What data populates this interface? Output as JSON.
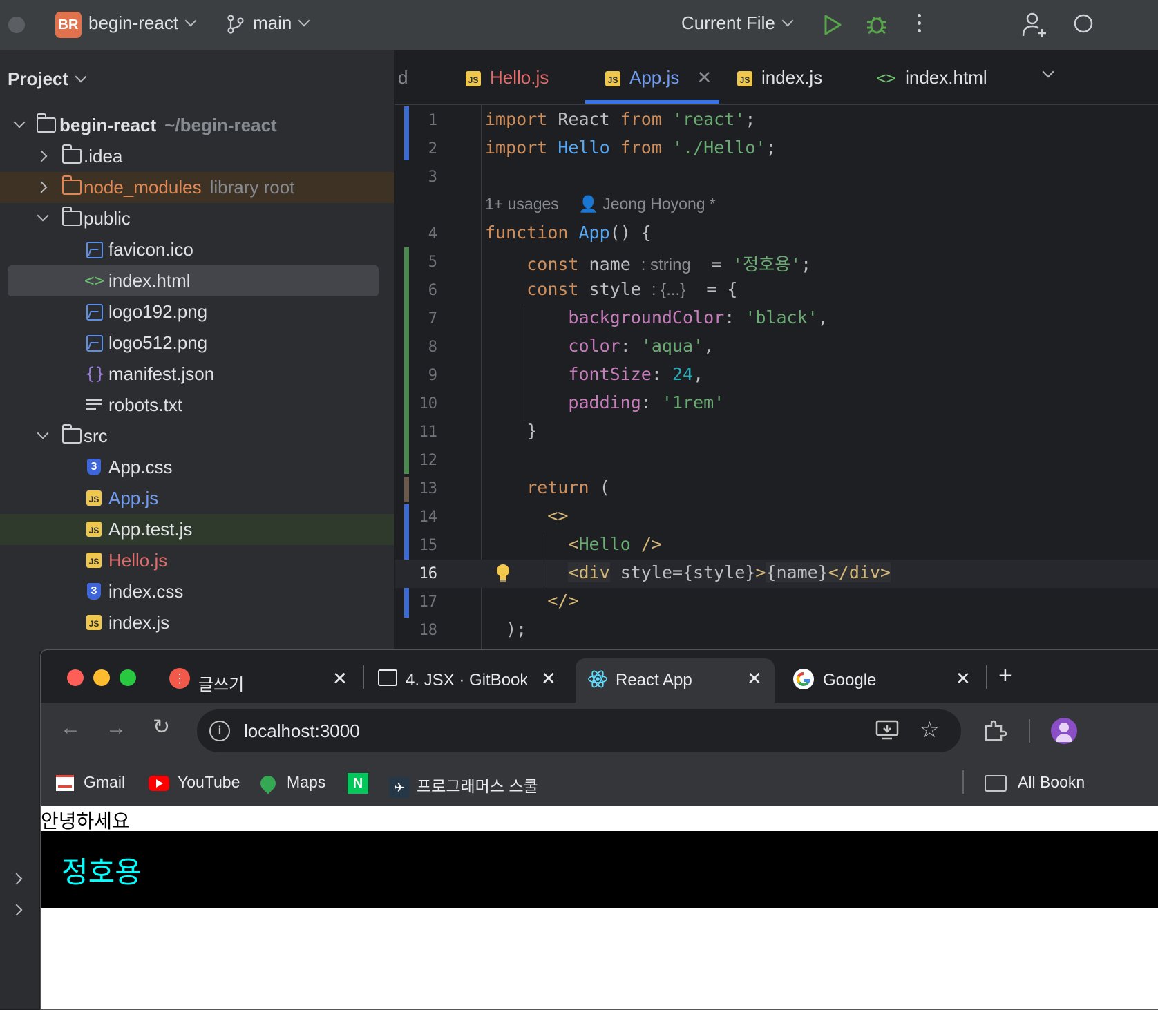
{
  "ide": {
    "project_badge": "BR",
    "project_name": "begin-react",
    "branch": "main",
    "run_config": "Current File",
    "project_panel_title": "Project",
    "tree": {
      "root_name": "begin-react",
      "root_path": "~/begin-react",
      "idea": ".idea",
      "node_modules": "node_modules",
      "node_modules_hint": "library root",
      "public": "public",
      "favicon": "favicon.ico",
      "index_html": "index.html",
      "logo192": "logo192.png",
      "logo512": "logo512.png",
      "manifest": "manifest.json",
      "robots": "robots.txt",
      "src": "src",
      "app_css": "App.css",
      "app_js": "App.js",
      "app_test": "App.test.js",
      "hello_js": "Hello.js",
      "index_css": "index.css",
      "index_js": "index.js"
    },
    "tabs": {
      "partial": "d",
      "hello": "Hello.js",
      "app": "App.js",
      "index_js": "index.js",
      "index_html": "index.html"
    },
    "editor": {
      "usages": "1+ usages",
      "author": "Jeong Hoyong *",
      "line_numbers": [
        "1",
        "2",
        "3",
        "4",
        "5",
        "6",
        "7",
        "8",
        "9",
        "10",
        "11",
        "12",
        "13",
        "14",
        "15",
        "16",
        "17",
        "18"
      ],
      "hint_string": ": string",
      "hint_obj": ": {...}"
    }
  },
  "browser": {
    "tabs": [
      {
        "title": "글쓰기"
      },
      {
        "title": "4. JSX · GitBook"
      },
      {
        "title": "React App"
      },
      {
        "title": "Google"
      }
    ],
    "url": "localhost:3000",
    "bookmarks": [
      "Gmail",
      "YouTube",
      "Maps",
      "프로그래머스 스쿨"
    ],
    "all_bookmarks": "All Bookn",
    "page": {
      "greeting": "안녕하세요",
      "name": "정호용"
    }
  }
}
